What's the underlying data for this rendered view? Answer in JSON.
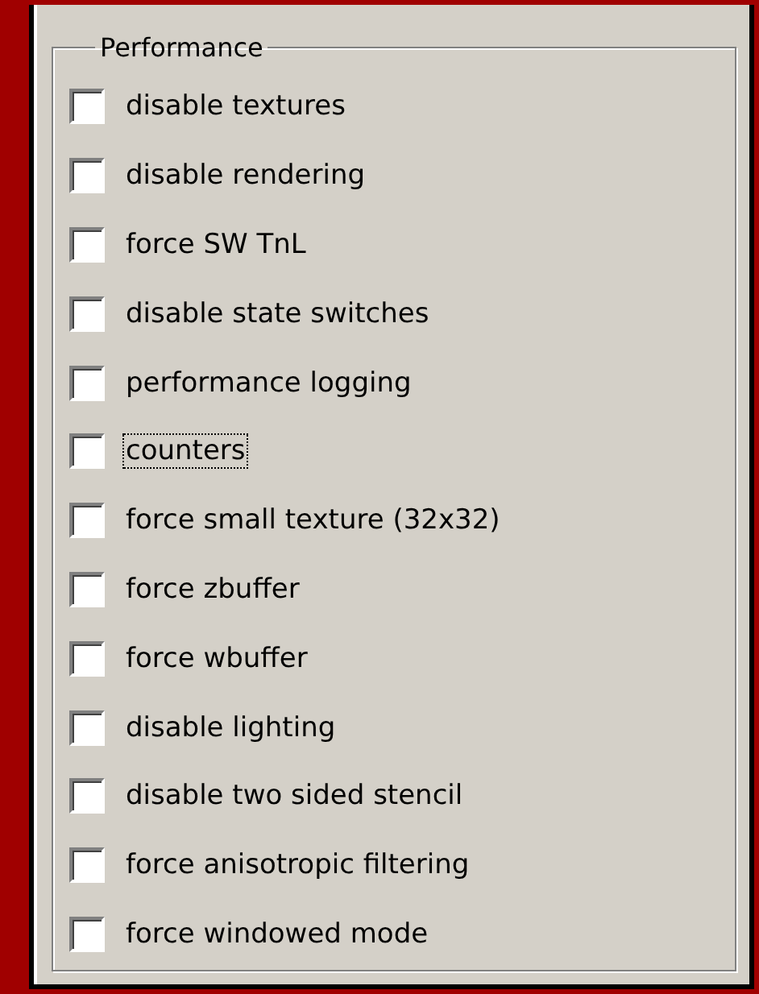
{
  "group": {
    "title": "Performance"
  },
  "options": [
    {
      "label": "disable textures",
      "checked": false,
      "focused": false
    },
    {
      "label": "disable rendering",
      "checked": false,
      "focused": false
    },
    {
      "label": "force SW TnL",
      "checked": false,
      "focused": false
    },
    {
      "label": "disable state switches",
      "checked": false,
      "focused": false
    },
    {
      "label": "performance logging",
      "checked": false,
      "focused": false
    },
    {
      "label": "counters",
      "checked": false,
      "focused": true
    },
    {
      "label": "force small texture (32x32)",
      "checked": false,
      "focused": false
    },
    {
      "label": "force zbuffer",
      "checked": false,
      "focused": false
    },
    {
      "label": "force wbuffer",
      "checked": false,
      "focused": false
    },
    {
      "label": "disable lighting",
      "checked": false,
      "focused": false
    },
    {
      "label": "disable two sided stencil",
      "checked": false,
      "focused": false
    },
    {
      "label": "force anisotropic filtering",
      "checked": false,
      "focused": false
    },
    {
      "label": "force windowed mode",
      "checked": false,
      "focused": false
    }
  ]
}
